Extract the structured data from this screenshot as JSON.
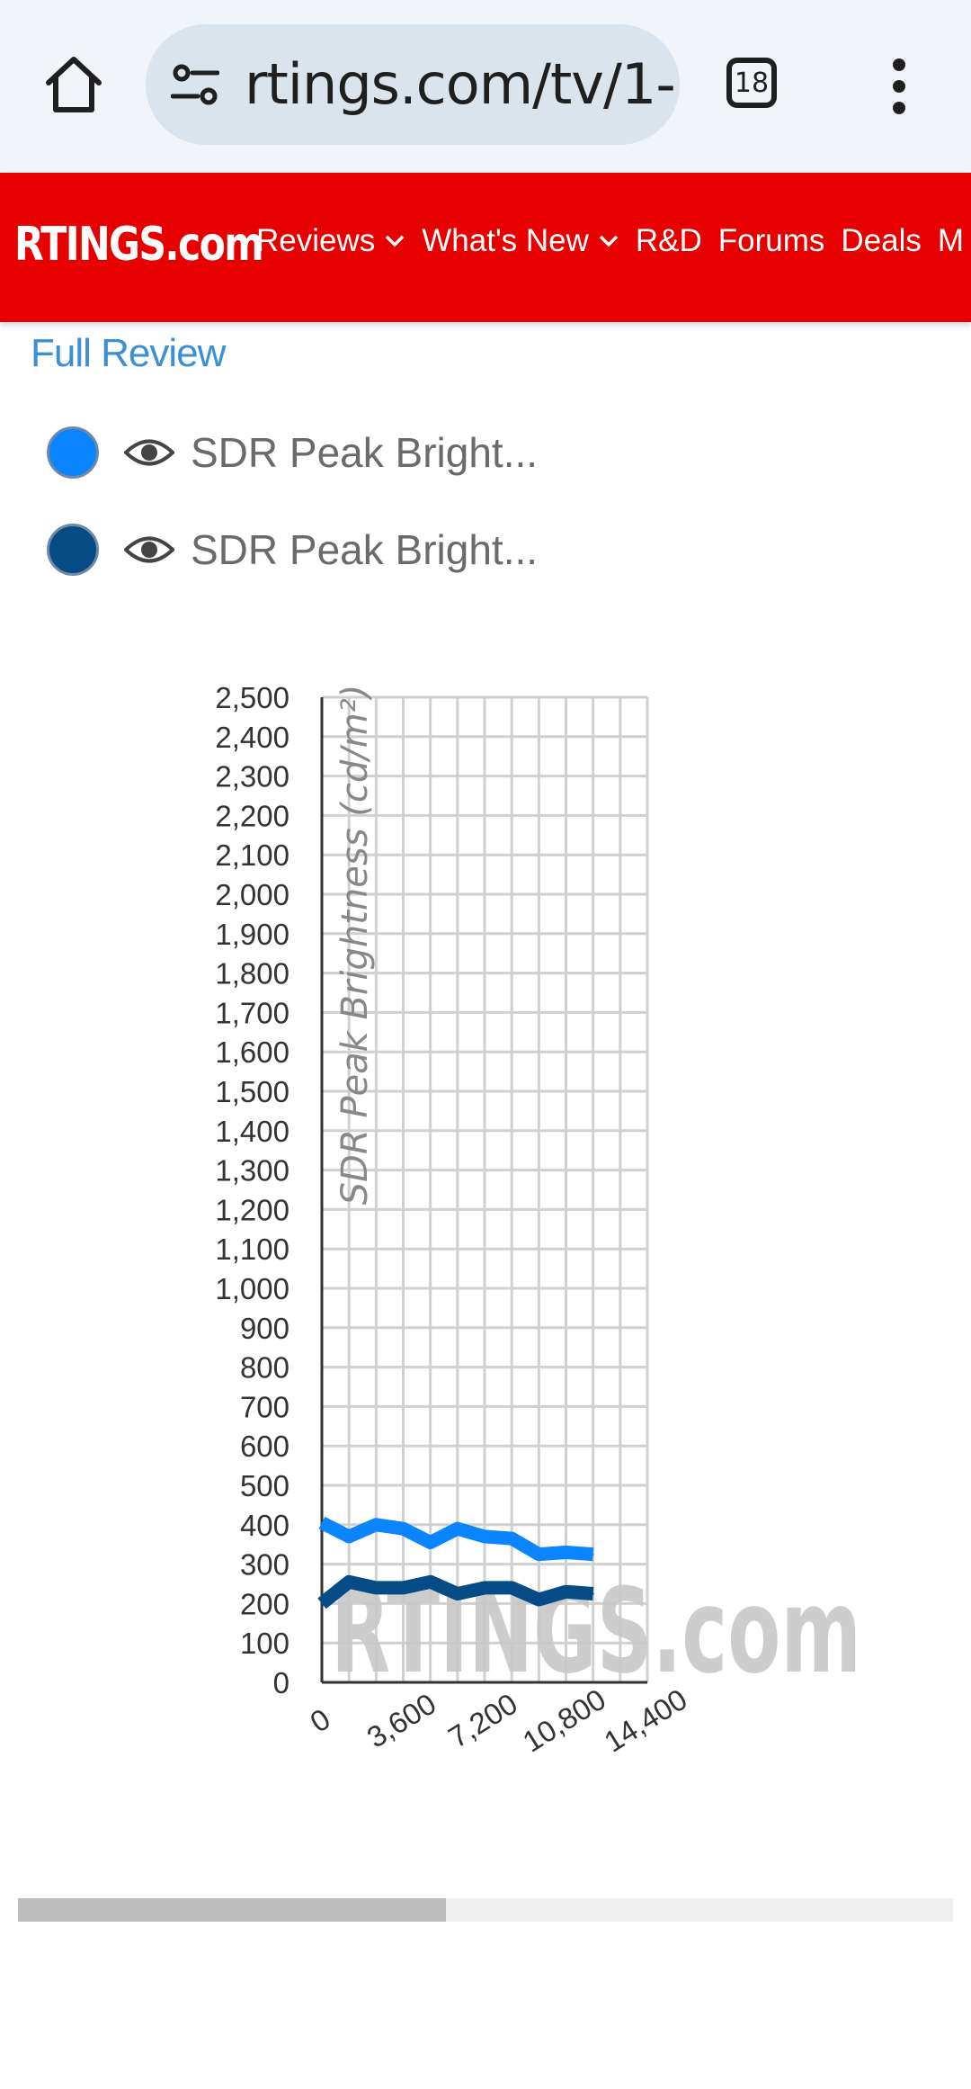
{
  "browser": {
    "url": "rtings.com/tv/1-",
    "tab_count": "18"
  },
  "site": {
    "logo_text": "RTINGS.com",
    "nav": [
      "Reviews",
      "What's New",
      "R&D",
      "Forums",
      "Deals",
      "M"
    ]
  },
  "full_review_link": "Full Review",
  "legend": [
    {
      "label": "SDR Peak Bright...",
      "color": "#0a84ff"
    },
    {
      "label": "SDR Peak Bright...",
      "color": "#054b86"
    }
  ],
  "chart_data": {
    "type": "line",
    "title": "",
    "xlabel": "",
    "ylabel": "SDR Peak Brightness (cd/m²)",
    "xlim": [
      0,
      14400
    ],
    "ylim": [
      0,
      2500
    ],
    "x_ticks": [
      "0",
      "3,600",
      "7,200",
      "10,800",
      "14,400"
    ],
    "y_ticks": [
      "0",
      "100",
      "200",
      "300",
      "400",
      "500",
      "600",
      "700",
      "800",
      "900",
      "1,000",
      "1,100",
      "1,200",
      "1,300",
      "1,400",
      "1,500",
      "1,600",
      "1,700",
      "1,800",
      "1,900",
      "2,000",
      "2,100",
      "2,200",
      "2,300",
      "2,400",
      "2,500"
    ],
    "grid": true,
    "watermark": "RTINGS.com",
    "x": [
      0,
      1200,
      2400,
      3600,
      4800,
      6000,
      7200,
      8400,
      9600,
      10800,
      12000
    ],
    "series": [
      {
        "color": "#0a84ff",
        "values": [
          405,
          370,
          400,
          390,
          355,
          390,
          370,
          365,
          325,
          330,
          325
        ]
      },
      {
        "color": "#054b86",
        "values": [
          200,
          255,
          240,
          240,
          255,
          225,
          240,
          240,
          210,
          230,
          225
        ]
      }
    ]
  },
  "scrollbar": {
    "position": 0.46
  }
}
